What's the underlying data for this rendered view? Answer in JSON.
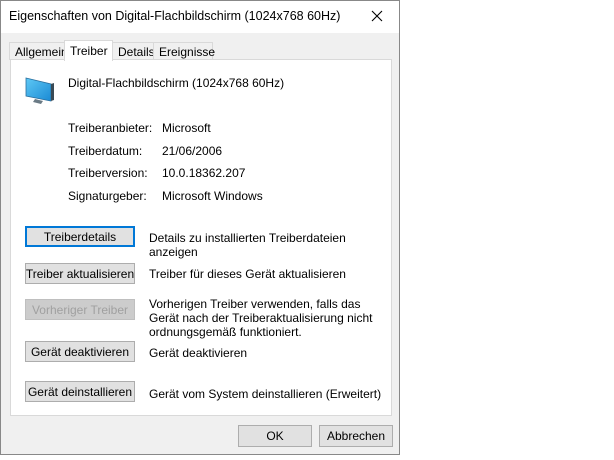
{
  "window": {
    "title": "Eigenschaften von Digital-Flachbildschirm (1024x768 60Hz)"
  },
  "tabs": [
    {
      "label": "Allgemein"
    },
    {
      "label": "Treiber",
      "active": true
    },
    {
      "label": "Details"
    },
    {
      "label": "Ereignisse"
    }
  ],
  "device": {
    "name": "Digital-Flachbildschirm (1024x768 60Hz)",
    "icon": "monitor-icon"
  },
  "info": [
    {
      "label": "Treiberanbieter:",
      "value": "Microsoft"
    },
    {
      "label": "Treiberdatum:",
      "value": "21/06/2006"
    },
    {
      "label": "Treiberversion:",
      "value": "10.0.18362.207"
    },
    {
      "label": "Signaturgeber:",
      "value": "Microsoft Windows"
    }
  ],
  "actions": [
    {
      "label": "Treiberdetails",
      "description": "Details zu installierten Treiberdateien anzeigen",
      "enabled": true
    },
    {
      "label": "Treiber aktualisieren",
      "description": "Treiber für dieses Gerät aktualisieren",
      "enabled": true
    },
    {
      "label": "Vorheriger Treiber",
      "description": "Vorherigen Treiber verwenden, falls das Gerät nach der Treiberaktualisierung nicht ordnungsgemäß funktioniert.",
      "enabled": false
    },
    {
      "label": "Gerät deaktivieren",
      "description": "Gerät deaktivieren",
      "enabled": true
    },
    {
      "label": "Gerät deinstallieren",
      "description": "Gerät vom System deinstallieren (Erweitert)",
      "enabled": true
    }
  ],
  "footer": {
    "ok": "OK",
    "cancel": "Abbrechen"
  },
  "colors": {
    "focus": "#0078d7",
    "dialog_bg": "#f0f0f0",
    "panel_bg": "#ffffff"
  }
}
